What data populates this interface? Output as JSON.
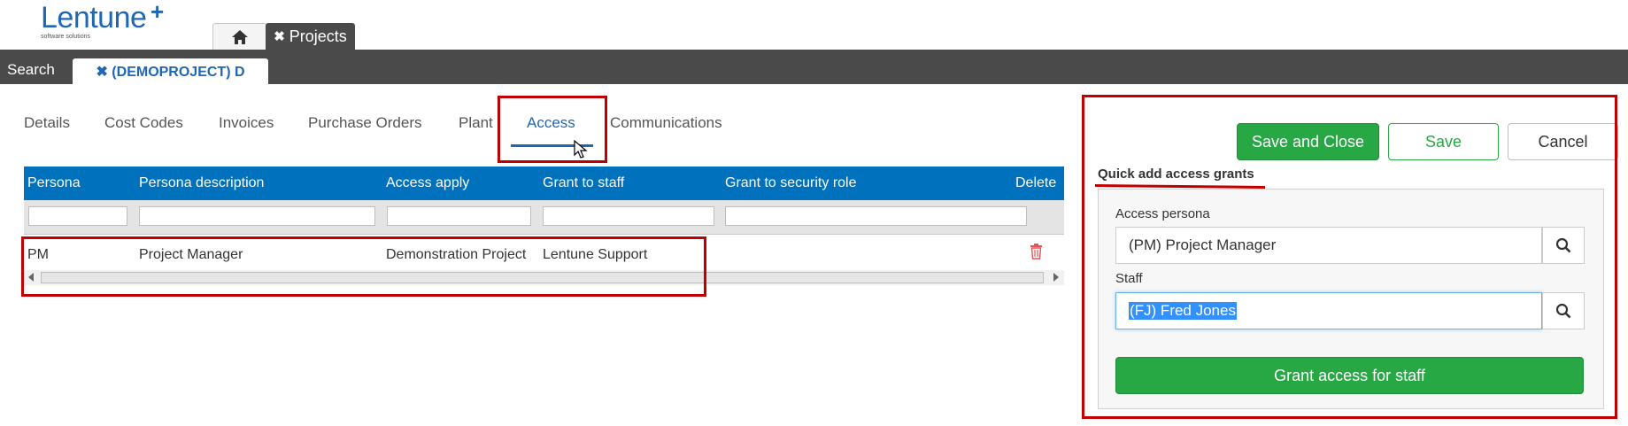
{
  "brand": {
    "name": "Lentune",
    "plus": "+",
    "tagline": "software solutions",
    "color": "#1f66b3"
  },
  "top_tabs": {
    "home_icon": "home-icon",
    "projects_label": "Projects",
    "close_glyph": "✖"
  },
  "toolbar": {
    "search_label": "Search",
    "record_tab_label": "✖ (DEMOPROJECT) D"
  },
  "section_tabs": [
    {
      "label": "Details"
    },
    {
      "label": "Cost Codes"
    },
    {
      "label": "Invoices"
    },
    {
      "label": "Purchase Orders"
    },
    {
      "label": "Plant"
    },
    {
      "label": "Access",
      "active": true
    },
    {
      "label": "Communications"
    }
  ],
  "grid": {
    "columns": [
      "Persona",
      "Persona description",
      "Access apply",
      "Grant to staff",
      "Grant to security role",
      "Delete"
    ],
    "header_color": "#0071bc",
    "rows": [
      {
        "persona": "PM",
        "description": "Project Manager",
        "access_apply": "Demonstration Project",
        "staff": "Lentune Support",
        "security_role": "",
        "delete_icon": "trash-icon"
      }
    ]
  },
  "panel": {
    "save_close_label": "Save and Close",
    "save_label": "Save",
    "cancel_label": "Cancel",
    "quick_add_title": "Quick add access grants",
    "access_persona_label": "Access persona",
    "access_persona_value": "(PM) Project Manager",
    "staff_label": "Staff",
    "staff_value": "(FJ) Fred Jones",
    "grant_button_label": "Grant access for staff",
    "accent_green": "#28a745",
    "highlight_red": "#c00000"
  }
}
